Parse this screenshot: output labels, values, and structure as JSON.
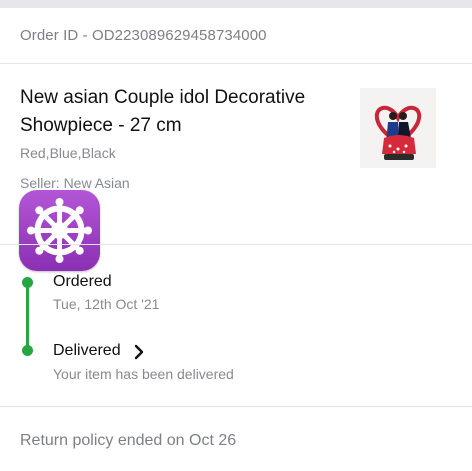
{
  "order": {
    "id_text": "Order ID - OD223089629458734000"
  },
  "product": {
    "title": "New asian Couple idol Decorative Showpiece - 27 cm",
    "variant": "Red,Blue,Black",
    "seller": "Seller: New Asian",
    "image_icon": "couple-figurine-thumbnail"
  },
  "overlay": {
    "icon": "wheel-of-dharma-emoji",
    "color": "#9b3fc4"
  },
  "timeline": {
    "color": "#26a541",
    "steps": [
      {
        "title": "Ordered",
        "subtitle": "Tue, 12th Oct '21"
      },
      {
        "title": "Delivered",
        "subtitle": "Your item has been delivered"
      }
    ]
  },
  "footer": {
    "return_policy": "Return policy ended on Oct 26"
  }
}
